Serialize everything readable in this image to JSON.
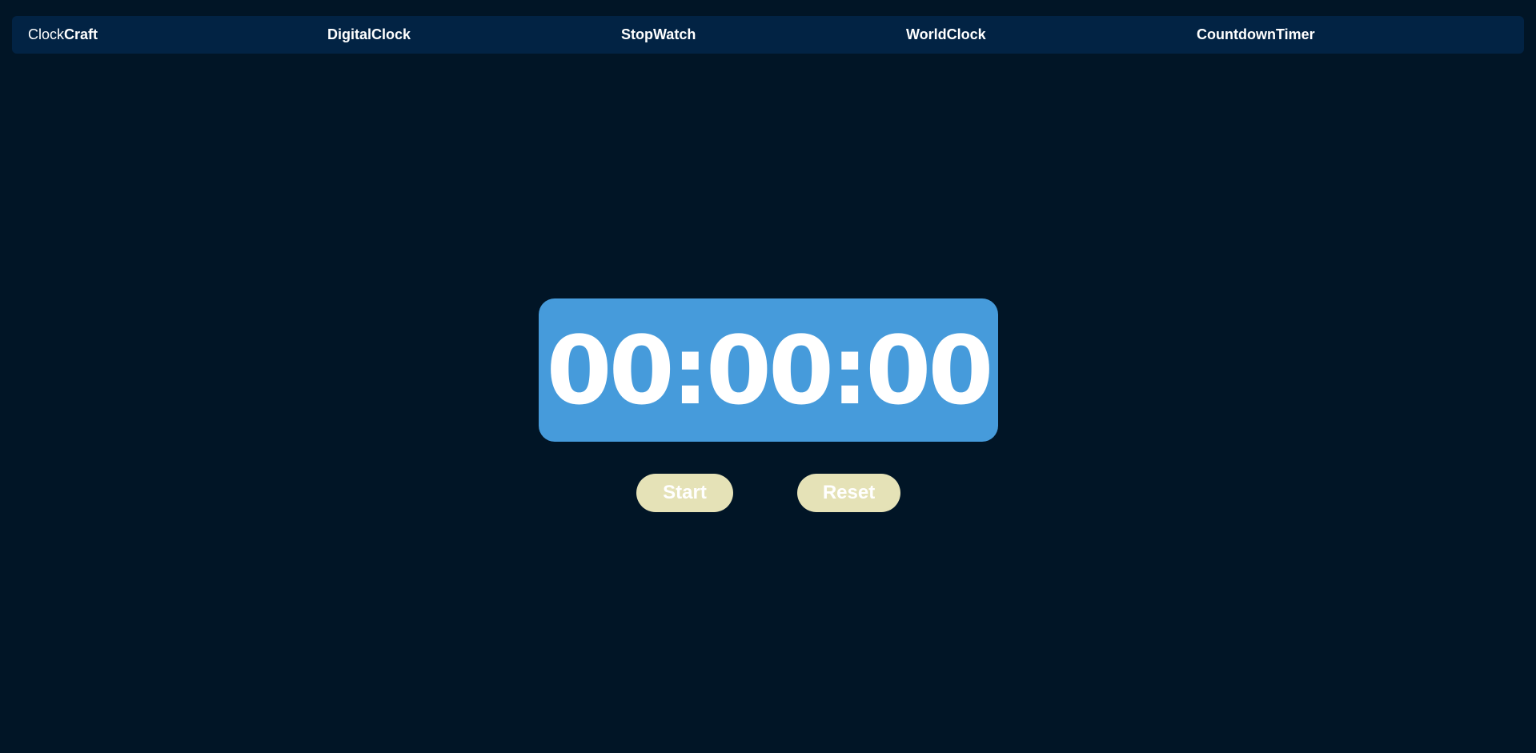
{
  "navbar": {
    "brand_light": "Clock",
    "brand_bold": "Craft",
    "links": [
      {
        "label": "DigitalClock"
      },
      {
        "label": "StopWatch"
      },
      {
        "label": "WorldClock"
      },
      {
        "label": "CountdownTimer"
      }
    ]
  },
  "timer": {
    "display": "00:00:00"
  },
  "controls": {
    "start_label": "Start",
    "reset_label": "Reset"
  },
  "colors": {
    "background": "#011526",
    "navbar": "#022344",
    "timer_box": "#469bdb",
    "button": "#e5e2b7",
    "text": "#ffffff"
  }
}
